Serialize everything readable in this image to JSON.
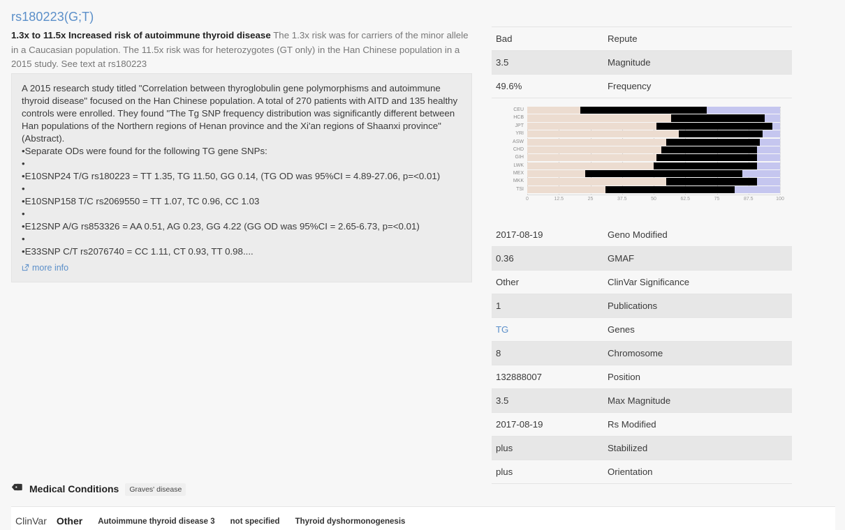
{
  "snp": {
    "title": "rs180223(G;T)",
    "summary_bold": "1.3x to 11.5x Increased risk of autoimmune thyroid disease",
    "summary_rest": " The 1.3x risk was for carriers of the minor allele in a Caucasian population. The 11.5x risk was for heterozygotes (GT only) in the Han Chinese population in a 2015 study. See text at rs180223"
  },
  "description": {
    "lines": [
      "A 2015 research study titled \"Correlation between thyroglobulin gene polymorphisms and autoimmune thyroid disease\" focused on the Han Chinese population. A total of 270 patients with AITD and 135 healthy controls were enrolled. They found \"The Tg SNP frequency distribution was significantly different between Han populations of the Northern regions of Henan province and the Xi'an regions of Shaanxi province\" (Abstract).",
      "•Separate ODs were found for the following TG gene SNPs:",
      "•",
      "•E10SNP24 T/G rs180223 = TT 1.35, TG 11.50, GG 0.14, (TG OD was 95%CI = 4.89-27.06, p=<0.01)",
      "•",
      "•E10SNP158 T/C rs2069550 = TT 1.07, TC 0.96, CC 1.03",
      "•",
      "•E12SNP A/G rs853326 = AA 0.51, AG 0.23, GG 4.22 (GG OD was 95%CI = 2.65-6.73, p=<0.01)",
      "•",
      "•E33SNP C/T rs2076740 = CC 1.11, CT 0.93, TT 0.98...."
    ],
    "more_info_label": "more info",
    "more_info_icon": "external-link-icon"
  },
  "summary_table": {
    "rows": [
      {
        "value": "Bad",
        "key": "Repute"
      },
      {
        "value": "3.5",
        "key": "Magnitude"
      },
      {
        "value": "49.6%",
        "key": "Frequency"
      }
    ]
  },
  "detail_table": {
    "rows": [
      {
        "value": "2017-08-19",
        "key": "Geno Modified",
        "link": false
      },
      {
        "value": "0.36",
        "key": "GMAF",
        "link": false
      },
      {
        "value": "Other",
        "key": "ClinVar Significance",
        "link": false
      },
      {
        "value": "1",
        "key": "Publications",
        "link": false
      },
      {
        "value": "TG",
        "key": "Genes",
        "link": true
      },
      {
        "value": "8",
        "key": "Chromosome",
        "link": false
      },
      {
        "value": "132888007",
        "key": "Position",
        "link": false
      },
      {
        "value": "3.5",
        "key": "Max Magnitude",
        "link": false
      },
      {
        "value": "2017-08-19",
        "key": "Rs Modified",
        "link": false
      },
      {
        "value": "plus",
        "key": "Stabilized",
        "link": false
      },
      {
        "value": "plus",
        "key": "Orientation",
        "link": false
      }
    ]
  },
  "medical_conditions": {
    "icon": "tag-icon",
    "label": "Medical Conditions",
    "chips": [
      "Graves' disease"
    ]
  },
  "clinvar": {
    "source_label": "ClinVar",
    "significance": "Other",
    "conditions": [
      "Autoimmune thyroid disease 3",
      "not specified",
      "Thyroid dyshormonogenesis"
    ]
  },
  "chart_data": {
    "type": "bar",
    "subtype": "stacked-horizontal",
    "title": "",
    "xlabel": "",
    "ylabel": "",
    "xlim": [
      0,
      100
    ],
    "grid": true,
    "legend_position": "none",
    "colors": {
      "segment_a": "#ecdcd0",
      "segment_b": "#000000",
      "segment_c": "#c5c6ef"
    },
    "series": [
      {
        "name": "a",
        "color": "#ecdcd0"
      },
      {
        "name": "b",
        "color": "#000000"
      },
      {
        "name": "c",
        "color": "#c5c6ef"
      }
    ],
    "tick_labels": [
      "0",
      "12.5",
      "25",
      "37.5",
      "50",
      "62.5",
      "75",
      "87.5",
      "100"
    ],
    "ticks": [
      0,
      12.5,
      25,
      37.5,
      50,
      62.5,
      75,
      87.5,
      100
    ],
    "categories": [
      "CEU",
      "HCB",
      "JPT",
      "YRI",
      "ASW",
      "CHD",
      "GIH",
      "LWK",
      "MEX",
      "MKK",
      "TSI"
    ],
    "rows": [
      {
        "category": "CEU",
        "a": 21.0,
        "b": 50.0,
        "c": 29.0
      },
      {
        "category": "HCB",
        "a": 57.0,
        "b": 37.0,
        "c": 6.0
      },
      {
        "category": "JPT",
        "a": 51.0,
        "b": 46.0,
        "c": 3.0
      },
      {
        "category": "YRI",
        "a": 60.0,
        "b": 33.0,
        "c": 7.0
      },
      {
        "category": "ASW",
        "a": 55.0,
        "b": 37.0,
        "c": 8.0
      },
      {
        "category": "CHD",
        "a": 53.0,
        "b": 38.0,
        "c": 9.0
      },
      {
        "category": "GIH",
        "a": 51.0,
        "b": 40.0,
        "c": 9.0
      },
      {
        "category": "LWK",
        "a": 50.0,
        "b": 41.0,
        "c": 9.0
      },
      {
        "category": "MEX",
        "a": 23.0,
        "b": 62.0,
        "c": 15.0
      },
      {
        "category": "MKK",
        "a": 55.0,
        "b": 36.0,
        "c": 9.0
      },
      {
        "category": "TSI",
        "a": 31.0,
        "b": 51.0,
        "c": 18.0
      }
    ]
  }
}
